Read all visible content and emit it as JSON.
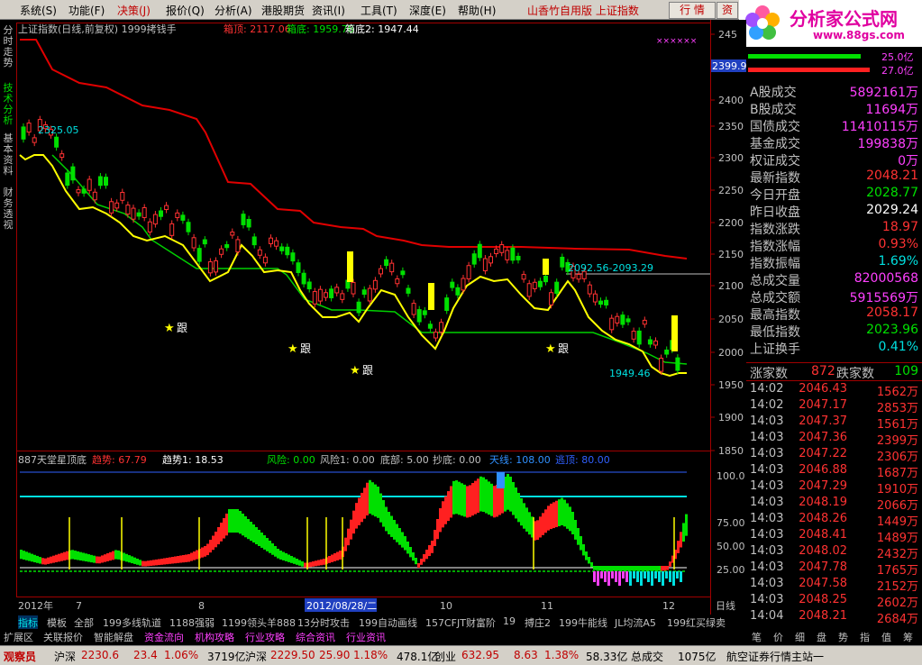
{
  "menubar": {
    "items": [
      "系统(S)",
      "功能(F)",
      "决策(J)",
      "报价(Q)",
      "分析(A)",
      "港股期货",
      "资讯(I)",
      "工具(T)",
      "深度(E)",
      "帮助(H)"
    ],
    "active_index": 2,
    "stock_label": "山香竹自用版  上证指数",
    "btn_quote": "行  情",
    "btn_info": "资"
  },
  "logo": {
    "title": "分析家公式网",
    "url": "www.88gs.com"
  },
  "vtabs": [
    "分时走势",
    "技术分析",
    "基本资料",
    "财务透视"
  ],
  "chart": {
    "title": "上证指数(日线,前复权) 1999拷钱手",
    "box_top_label": "箱顶: 2117.06",
    "box_bottom_label": "箱底: 1959.78",
    "box_bottom2_label": "箱底2: 1947.44",
    "price_axis": [
      "245",
      "2400",
      "2350",
      "2300",
      "2250",
      "2200",
      "2150",
      "2100",
      "2050",
      "2000",
      "1950",
      "1900",
      "1850"
    ],
    "current_price_tag": "2399.9",
    "high_label": "2325.05",
    "range_label": "2092.56-2093.29",
    "low_label": "1949.46",
    "gen_label": "跟",
    "lower_title": "887天堂星顶底",
    "trend_label": "趋势: 67.79",
    "trend1_label": "趋势1: 18.53",
    "risk_label": "风险: 0.00",
    "risk1_label": "风险1: 0.00",
    "bottom_label": "底部: 5.00",
    "chaodi_label": "抄底: 0.00",
    "tianxian_label": "天线: 108.00",
    "tiantou_label": "逃顶: 80.00",
    "lower_axis": [
      "100.0",
      "75.00",
      "50.00",
      "25.00"
    ],
    "x_labels": [
      "2012年",
      "7",
      "8",
      "9",
      "10",
      "11",
      "12"
    ],
    "x_selected": "2012/08/28/二",
    "period": "日线"
  },
  "right": {
    "vol_up": "25.0亿",
    "vol_dn": "27.0亿",
    "rows": [
      {
        "k": "A股成交",
        "v": "5892161万",
        "c": "#ff40ff"
      },
      {
        "k": "B股成交",
        "v": "11694万",
        "c": "#ff40ff"
      },
      {
        "k": "国债成交",
        "v": "11410115万",
        "c": "#ff40ff"
      },
      {
        "k": "基金成交",
        "v": "199838万",
        "c": "#ff40ff"
      },
      {
        "k": "权证成交",
        "v": "0万",
        "c": "#ff40ff"
      },
      {
        "k": "最新指数",
        "v": "2048.21",
        "c": "#ff3232"
      },
      {
        "k": "今日开盘",
        "v": "2028.77",
        "c": "#00e000"
      },
      {
        "k": "昨日收盘",
        "v": "2029.24",
        "c": "#ffffff"
      },
      {
        "k": "指数涨跌",
        "v": "18.97",
        "c": "#ff3232"
      },
      {
        "k": "指数涨幅",
        "v": "0.93%",
        "c": "#ff3232"
      },
      {
        "k": "指数振幅",
        "v": "1.69%",
        "c": "#00e0e0"
      },
      {
        "k": "总成交量",
        "v": "82000568",
        "c": "#ff40ff"
      },
      {
        "k": "总成交额",
        "v": "5915569万",
        "c": "#ff40ff"
      },
      {
        "k": "最高指数",
        "v": "2058.17",
        "c": "#ff3232"
      },
      {
        "k": "最低指数",
        "v": "2023.96",
        "c": "#00e000"
      },
      {
        "k": "上证换手",
        "v": "0.41%",
        "c": "#00e0e0"
      }
    ],
    "up_label": "涨家数",
    "up_value": "872",
    "down_label": "跌家数",
    "down_value": "109",
    "ticks": [
      [
        "14:02",
        "2046.43",
        "1562万"
      ],
      [
        "14:02",
        "2047.17",
        "2853万"
      ],
      [
        "14:03",
        "2047.37",
        "1561万"
      ],
      [
        "14:03",
        "2047.36",
        "2399万"
      ],
      [
        "14:03",
        "2047.22",
        "2306万"
      ],
      [
        "14:03",
        "2046.88",
        "1687万"
      ],
      [
        "14:03",
        "2047.29",
        "1910万"
      ],
      [
        "14:03",
        "2048.19",
        "2066万"
      ],
      [
        "14:03",
        "2048.26",
        "1449万"
      ],
      [
        "14:03",
        "2048.41",
        "1489万"
      ],
      [
        "14:03",
        "2048.02",
        "2432万"
      ],
      [
        "14:03",
        "2047.78",
        "1765万"
      ],
      [
        "14:03",
        "2047.58",
        "2152万"
      ],
      [
        "14:03",
        "2048.25",
        "2602万"
      ],
      [
        "14:04",
        "2048.21",
        "2684万"
      ]
    ],
    "tabs": [
      "笔",
      "价",
      "细",
      "盘",
      "势",
      "指",
      "值",
      "筹"
    ]
  },
  "tabs1": [
    "指标",
    "模板",
    "全部",
    "199多线轨道",
    "1188强弱",
    "1199领头羊888",
    "13分时攻击",
    "199自动画线",
    "157CFJT财富阶",
    "19",
    "搏庄2",
    "199牛能线",
    "JL均流A5",
    "199红买绿卖"
  ],
  "tabs2": [
    "扩展区",
    "关联报价",
    "智能解盘",
    "资金流向",
    "机构攻略",
    "行业攻略",
    "综合资讯",
    "行业资讯"
  ],
  "status": {
    "label": "观察员",
    "sh_name": "沪深",
    "sh_val": "2230.6",
    "sh_chg": "23.4",
    "sh_pct": "1.06%",
    "sh_amt": "3719亿",
    "sz_name": "沪深",
    "sz_val": "2229.50",
    "sz_chg": "25.90",
    "sz_pct": "1.18%",
    "sz_amt": "478.1亿",
    "cy_name": "创业",
    "cy_val": "632.95",
    "cy_chg": "8.63",
    "cy_pct": "1.38%",
    "cy_amt": "58.33亿",
    "total_label": "总成交",
    "total_val": "1075亿",
    "broker": "航空证券行情主站一"
  },
  "colors": {
    "up": "#ff3232",
    "down": "#00e000",
    "boxtop": "#e00000",
    "yellow": "#ffff00",
    "cyan": "#00e0e0",
    "magenta": "#ff40ff"
  }
}
